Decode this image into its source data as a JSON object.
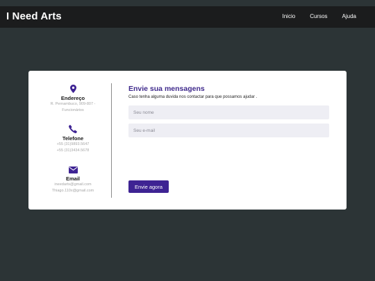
{
  "header": {
    "brand": "I Need Arts",
    "nav": [
      {
        "label": "Inicio"
      },
      {
        "label": "Cursos"
      },
      {
        "label": "Ajuda"
      }
    ]
  },
  "contact_info": {
    "address": {
      "icon": "map-pin-icon",
      "title": "Endereço",
      "lines": [
        "R. Pernambuco, 909-807 -",
        "Funcionários"
      ]
    },
    "phone": {
      "icon": "phone-icon",
      "title": "Telefone",
      "lines": [
        "+55 (31)9893.5647",
        "+55 (31)3434.5678"
      ]
    },
    "email": {
      "icon": "envelope-icon",
      "title": "Email",
      "lines": [
        "ineedarts@gmail.com",
        "Thiago.110x@gmail.com"
      ]
    }
  },
  "form": {
    "title": "Envie sua mensagens",
    "subtitle": "Caso tenha alguma duvida nos contactar para que possamos ajudar .",
    "name_placeholder": "Seu nome",
    "email_placeholder": "Seu e-mail",
    "submit_label": "Envie agora"
  },
  "colors": {
    "accent": "#3e2393",
    "navbar": "#1b1c1d",
    "background": "#2c3436",
    "field": "#eeeef4"
  }
}
